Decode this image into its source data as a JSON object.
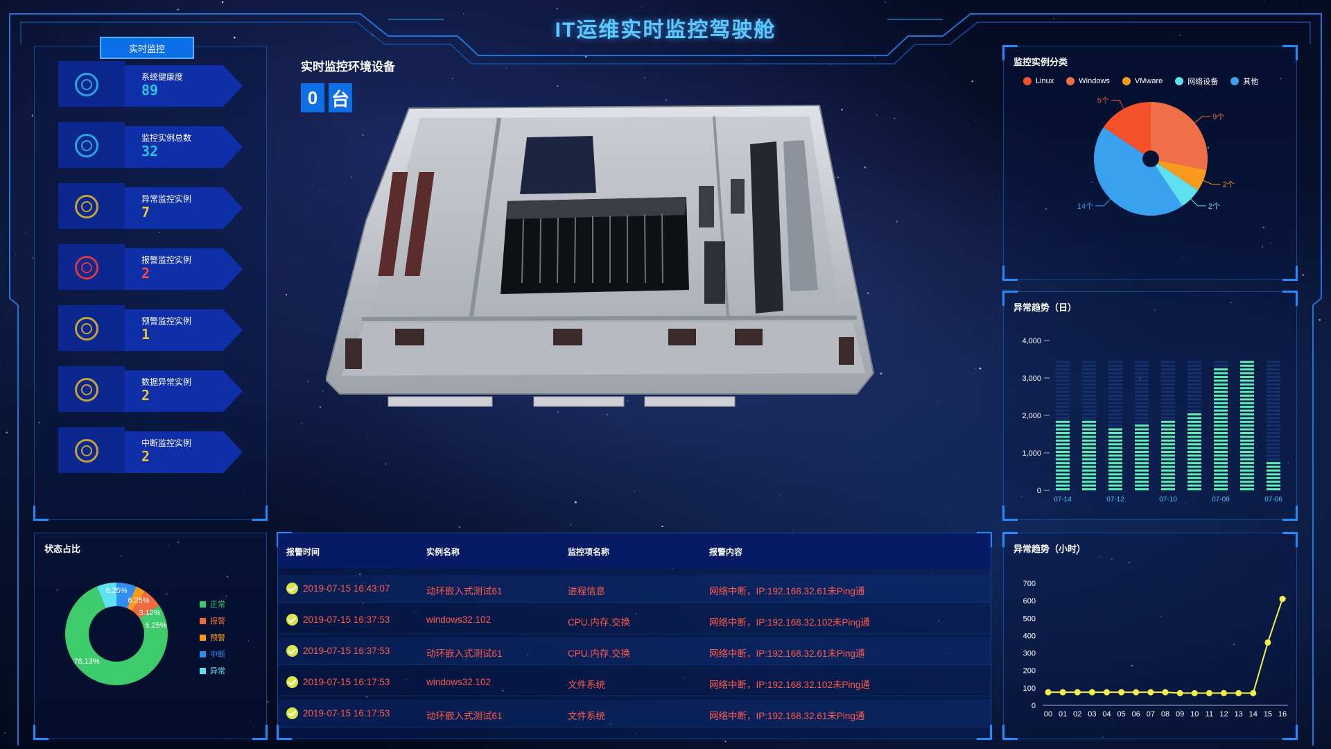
{
  "header": {
    "title": "IT运维实时监控驾驶舱"
  },
  "monitor": {
    "tab_label": "实时监控",
    "metrics": [
      {
        "label": "系统健康度",
        "value": "89",
        "color": "#27c7e8",
        "icon": "health-icon",
        "ring": "#27a7e0"
      },
      {
        "label": "监控实例总数",
        "value": "32",
        "color": "#27c7e8",
        "icon": "instances-icon",
        "ring": "#27a7e0"
      },
      {
        "label": "异常监控实例",
        "value": "7",
        "color": "#e8c23a",
        "icon": "abnormal-icon",
        "ring": "#c9a236"
      },
      {
        "label": "报警监控实例",
        "value": "2",
        "color": "#ff4747",
        "icon": "alarm-icon",
        "ring": "#d63a3a"
      },
      {
        "label": "预警监控实例",
        "value": "1",
        "color": "#e8c23a",
        "icon": "warning-icon",
        "ring": "#c9a236"
      },
      {
        "label": "数据异常实例",
        "value": "2",
        "color": "#e8c23a",
        "icon": "data-abnormal-icon",
        "ring": "#c9a236"
      },
      {
        "label": "中断监控实例",
        "value": "2",
        "color": "#e8c23a",
        "icon": "interrupt-icon",
        "ring": "#c9a236"
      }
    ]
  },
  "center": {
    "title": "实时监控环境设备",
    "count": "0",
    "unit": "台"
  },
  "category": {
    "title": "监控实例分类",
    "legend": [
      {
        "name": "Linux",
        "color": "#f5522c"
      },
      {
        "name": "Windows",
        "color": "#ef7048"
      },
      {
        "name": "VMware",
        "color": "#f79a1e"
      },
      {
        "name": "网络设备",
        "color": "#5ee0ee"
      },
      {
        "name": "其他",
        "color": "#3aa0f0"
      }
    ]
  },
  "daily": {
    "title": "异常趋势（日）"
  },
  "hourly": {
    "title": "异常趋势（小时）"
  },
  "status": {
    "title": "状态占比",
    "legend": [
      {
        "name": "正常",
        "color": "#3ecb6c"
      },
      {
        "name": "报警",
        "color": "#f06a40"
      },
      {
        "name": "预警",
        "color": "#f79a1e"
      },
      {
        "name": "中断",
        "color": "#2e8df0"
      },
      {
        "name": "异常",
        "color": "#5ee0ee"
      }
    ]
  },
  "alarms": {
    "headers": {
      "time": "报警时间",
      "instance": "实例名称",
      "item": "监控项名称",
      "content": "报警内容"
    },
    "rows": [
      {
        "time": "2019-07-15 16:43:07",
        "instance": "动环嵌入式测试61",
        "item": "进程信息",
        "content": "网络中断，IP:192.168.32.61未Ping通"
      },
      {
        "time": "2019-07-15 16:37:53",
        "instance": "windows32.102",
        "item": "CPU.内存.交换",
        "content": "网络中断，IP:192.168.32.102未Ping通"
      },
      {
        "time": "2019-07-15 16:37:53",
        "instance": "动环嵌入式测试61",
        "item": "CPU.内存.交换",
        "content": "网络中断，IP:192.168.32.61未Ping通"
      },
      {
        "time": "2019-07-15 16:17:53",
        "instance": "windows32.102",
        "item": "文件系统",
        "content": "网络中断，IP:192.168.32.102未Ping通"
      },
      {
        "time": "2019-07-15 16:17:53",
        "instance": "动环嵌入式测试61",
        "item": "文件系统",
        "content": "网络中断，IP:192.168.32.61未Ping通"
      }
    ]
  },
  "chart_data": [
    {
      "type": "pie",
      "title": "监控实例分类",
      "categories": [
        "Linux",
        "Windows",
        "VMware",
        "网络设备",
        "其他"
      ],
      "values": [
        5,
        9,
        2,
        2,
        14
      ],
      "labels": [
        "5个",
        "9个",
        "2个",
        "2个",
        "14个"
      ],
      "legend": "top"
    },
    {
      "type": "bar",
      "title": "异常趋势（日）",
      "categories": [
        "07-14",
        "07-13",
        "07-12",
        "07-11",
        "07-10",
        "07-09",
        "07-08",
        "07-07",
        "07-06"
      ],
      "tick_labels": [
        "07-14",
        "07-12",
        "07-10",
        "07-08",
        "07-06"
      ],
      "values": [
        1900,
        1900,
        1750,
        1780,
        1900,
        2100,
        3300,
        3550,
        800
      ],
      "ylim": [
        0,
        4000
      ],
      "yticks": [
        "0",
        "1,000",
        "2,000",
        "3,000",
        "4,000"
      ],
      "max": 3500
    },
    {
      "type": "line",
      "title": "异常趋势（小时）",
      "x": [
        "00",
        "01",
        "02",
        "03",
        "04",
        "05",
        "06",
        "07",
        "08",
        "09",
        "10",
        "11",
        "12",
        "13",
        "14",
        "15",
        "16"
      ],
      "values": [
        75,
        75,
        75,
        75,
        75,
        75,
        75,
        75,
        75,
        70,
        70,
        70,
        70,
        70,
        70,
        360,
        610
      ],
      "ylim": [
        0,
        700
      ],
      "yticks": [
        "0",
        "100",
        "200",
        "300",
        "400",
        "500",
        "600",
        "700"
      ],
      "color": "#f4f04a"
    },
    {
      "type": "pie",
      "title": "状态占比",
      "categories": [
        "正常",
        "报警",
        "预警",
        "中断",
        "异常"
      ],
      "values": [
        78.13,
        6.25,
        3.12,
        6.25,
        6.25
      ],
      "labels": [
        "78.13%",
        "6.25%",
        "3.12%",
        "6.25%",
        "6.25%"
      ],
      "legend": "right"
    }
  ]
}
